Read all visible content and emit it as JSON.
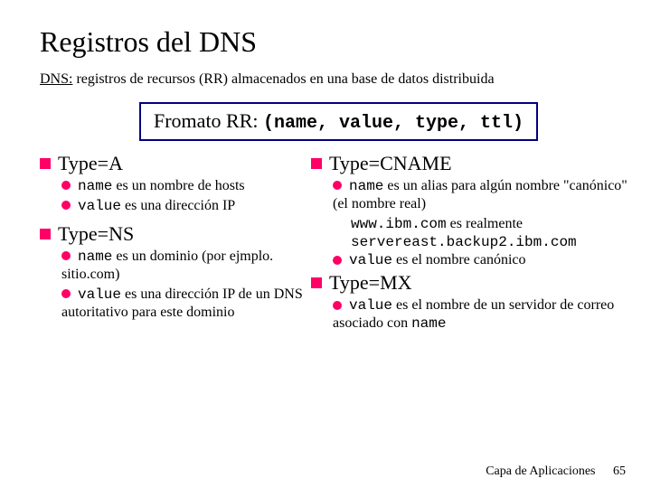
{
  "title": "Registros del DNS",
  "subtitle": {
    "label": "DNS:",
    "rest": " registros de recursos  (RR) almacenados en una base de datos distribuida"
  },
  "format": {
    "label": "Fromato RR: ",
    "tuple": "(name, value, type, ttl)"
  },
  "left": {
    "typeA": {
      "heading": "Type=A",
      "l1a": "name",
      "l1b": " es un nombre de hosts",
      "l2a": "value",
      "l2b": " es una dirección IP"
    },
    "typeNS": {
      "heading": "Type=NS",
      "l1a": "name",
      "l1b": " es un dominio (por ejmplo. sitio.com)",
      "l2a": "value",
      "l2b": " es una dirección IP de un DNS autoritativo para este dominio"
    }
  },
  "right": {
    "typeCNAME": {
      "heading": "Type=CNAME",
      "l1a": "name",
      "l1b": " es un alias para algún nombre \"canónico\" (el nombre real)",
      "ex1a": "www.ibm.com",
      "ex1b": " es realmente",
      "ex2": "servereast.backup2.ibm.com",
      "l2a": "value",
      "l2b": " es el nombre canónico"
    },
    "typeMX": {
      "heading": "Type=MX",
      "l1a": "value",
      "l1b": " es el nombre de un servidor de correo asociado con ",
      "l1c": "name"
    }
  },
  "footer": {
    "text": "Capa de Aplicaciones",
    "page": "65"
  }
}
